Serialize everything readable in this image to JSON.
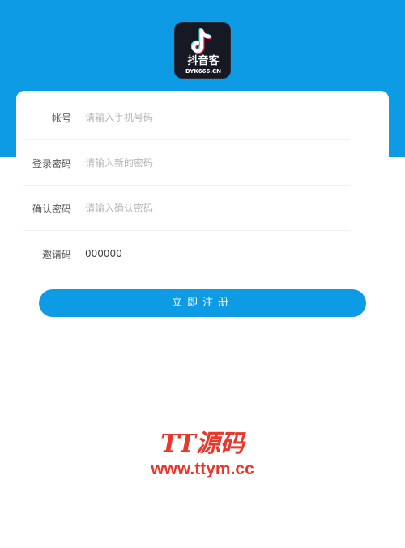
{
  "logo": {
    "name_cn": "抖音客",
    "name_en": "DYK666.CN",
    "icon": "music-note-icon"
  },
  "form": {
    "fields": [
      {
        "label": "帐号",
        "placeholder": "请输入手机号码",
        "value": ""
      },
      {
        "label": "登录密码",
        "placeholder": "请输入新的密码",
        "value": ""
      },
      {
        "label": "确认密码",
        "placeholder": "请输入确认密码",
        "value": ""
      },
      {
        "label": "邀请码",
        "placeholder": "",
        "value": "000000"
      }
    ],
    "submit_label": "立即注册"
  },
  "watermark": {
    "title": "TT源码",
    "url": "www.ttym.cc"
  },
  "colors": {
    "primary": "#0e9be6",
    "watermark": "#e8372b",
    "logo_bg": "#161823"
  }
}
